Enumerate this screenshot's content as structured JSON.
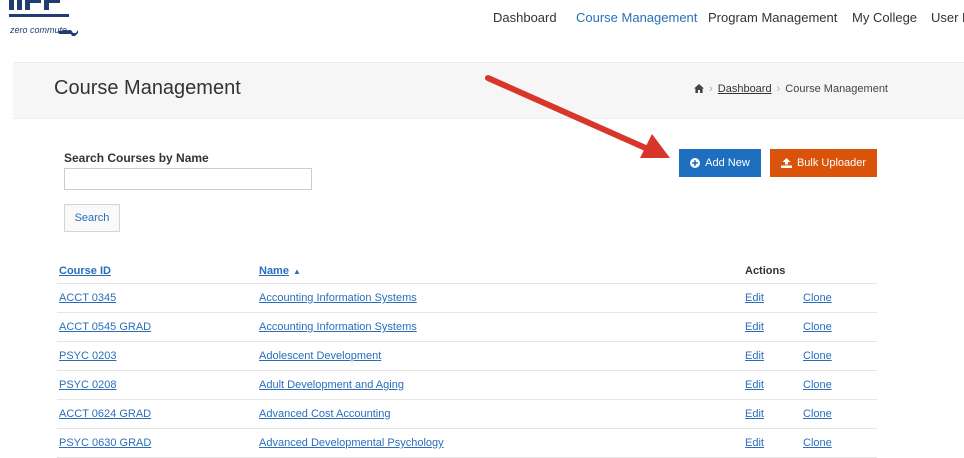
{
  "logo": {
    "tagline": "zero commute."
  },
  "nav": {
    "items": [
      {
        "label": "Dashboard"
      },
      {
        "label": "Course Management",
        "active": true
      },
      {
        "label": "Program Management"
      },
      {
        "label": "My College"
      },
      {
        "label": "User M"
      }
    ]
  },
  "header": {
    "title": "Course Management",
    "breadcrumb": {
      "home_icon": "home-icon",
      "dashboard": "Dashboard",
      "current": "Course Management"
    }
  },
  "search": {
    "label": "Search Courses by Name",
    "value": "",
    "button": "Search"
  },
  "actions": {
    "add_new": "Add New",
    "bulk_uploader": "Bulk Uploader",
    "add_icon": "plus-circle-icon",
    "upload_icon": "upload-icon"
  },
  "colors": {
    "primary": "#1e6fbf",
    "orange": "#d9530b",
    "link": "#2a6ebb",
    "annotation": "#d9362b"
  },
  "table": {
    "headers": {
      "course_id": "Course ID",
      "name": "Name",
      "actions": "Actions"
    },
    "sort": {
      "column": "Name",
      "direction": "ascending",
      "icon": "sort-up-icon"
    },
    "rows": [
      {
        "id": "ACCT 0345",
        "name": "Accounting Information Systems",
        "edit": "Edit",
        "clone": "Clone"
      },
      {
        "id": "ACCT 0545 GRAD",
        "name": "Accounting Information Systems",
        "edit": "Edit",
        "clone": "Clone"
      },
      {
        "id": "PSYC 0203",
        "name": "Adolescent Development",
        "edit": "Edit",
        "clone": "Clone"
      },
      {
        "id": "PSYC 0208",
        "name": "Adult Development and Aging",
        "edit": "Edit",
        "clone": "Clone"
      },
      {
        "id": "ACCT 0624 GRAD",
        "name": "Advanced Cost Accounting",
        "edit": "Edit",
        "clone": "Clone"
      },
      {
        "id": "PSYC 0630 GRAD",
        "name": "Advanced Developmental Psychology",
        "edit": "Edit",
        "clone": "Clone"
      }
    ]
  }
}
